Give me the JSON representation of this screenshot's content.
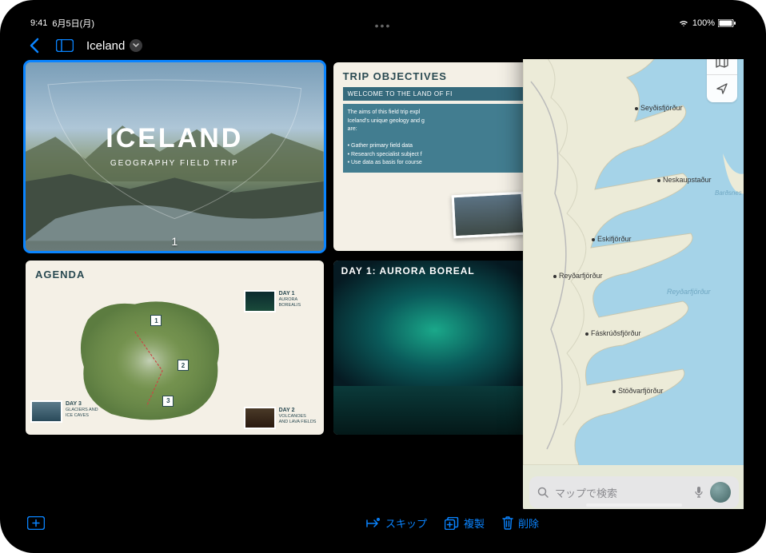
{
  "status": {
    "time": "9:41",
    "date": "6月5日(月)",
    "battery": "100%"
  },
  "toolbar": {
    "doc_title": "Iceland"
  },
  "slides": {
    "s1": {
      "title": "ICELAND",
      "subtitle": "GEOGRAPHY FIELD TRIP",
      "number": "1"
    },
    "s2": {
      "heading": "TRIP OBJECTIVES",
      "welcome": "WELCOME TO THE LAND OF FI",
      "aims_intro": "The aims of this field trip expl\nIceland's unique geology and g\nare:",
      "b1": "• Gather primary field data",
      "b2": "• Research specialist subject f",
      "b3": "• Use data as basis for course"
    },
    "s3": {
      "heading": "AGENDA",
      "day1": {
        "d": "DAY 1",
        "t": "AURORA\nBOREALIS"
      },
      "day2": {
        "d": "DAY 2",
        "t": "VOLCANOES\nAND LAVA FIELDS"
      },
      "day3": {
        "d": "DAY 3",
        "t": "GLACIERS AND\nICE CAVES"
      },
      "m1": "1",
      "m2": "2",
      "m3": "3"
    },
    "s4": {
      "heading": "DAY 1: AURORA BOREAL"
    }
  },
  "maps": {
    "places": {
      "seydis": "Seyðisfjörður",
      "neskaup": "Neskaupstaður",
      "eskif": "Eskifjörður",
      "reydar": "Reyðarfjörður",
      "faskrud": "Fáskrúðsfjörður",
      "stodvar": "Stöðvarfjörður",
      "bardsnes": "Barðsnes",
      "reydarfjordur_sea": "Reyðarfjörður"
    },
    "search_placeholder": "マップで検索"
  },
  "bottom": {
    "skip": "スキップ",
    "duplicate": "複製",
    "delete": "削除"
  }
}
